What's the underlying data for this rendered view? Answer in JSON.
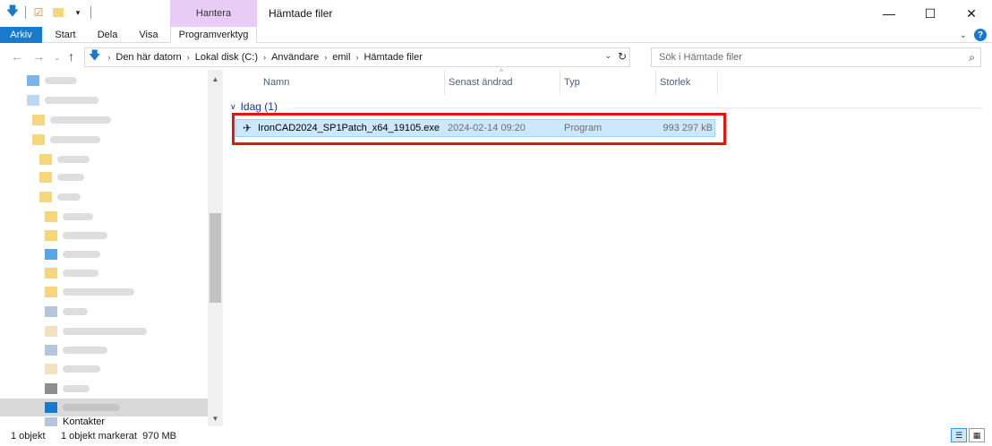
{
  "window": {
    "title": "Hämtade filer",
    "contextual_tab": "Hantera",
    "min_icon": "minimize-icon",
    "max_icon": "maximize-icon",
    "close_icon": "close-icon"
  },
  "ribbon": {
    "tabs": [
      {
        "label": "Arkiv"
      },
      {
        "label": "Start"
      },
      {
        "label": "Dela"
      },
      {
        "label": "Visa"
      },
      {
        "label": "Programverktyg"
      }
    ],
    "help": "?"
  },
  "address": {
    "crumbs": [
      "Den här datorn",
      "Lokal disk (C:)",
      "Användare",
      "emil",
      "Hämtade filer"
    ],
    "search_placeholder": "Sök i Hämtade filer"
  },
  "navpane": {
    "visible_label": "Kontakter"
  },
  "columns": {
    "name": "Namn",
    "date": "Senast ändrad",
    "type": "Typ",
    "size": "Storlek"
  },
  "group": {
    "label": "Idag (1)"
  },
  "files": [
    {
      "name": "IronCAD2024_SP1Patch_x64_19105.exe",
      "date": "2024-02-14 09:20",
      "type": "Program",
      "size": "993 297 kB"
    }
  ],
  "status": {
    "count": "1 objekt",
    "selected": "1 objekt markerat  970 MB"
  },
  "colors": {
    "accent": "#1979ca",
    "contextual": "#e9ccf5",
    "selection": "#cce8ff",
    "annotation": "#e8140c"
  }
}
